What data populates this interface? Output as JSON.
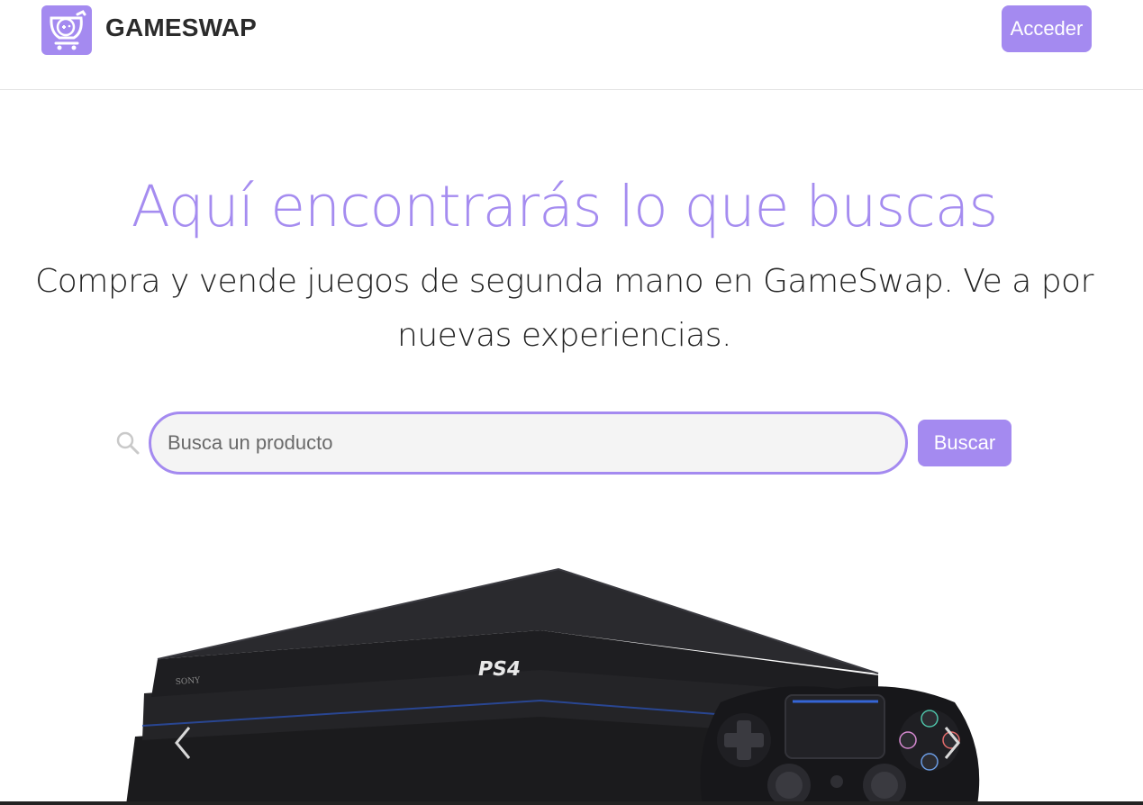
{
  "header": {
    "brand": "GAMESWAP",
    "logo_icon": "gamepad-cart-icon",
    "login_label": "Acceder"
  },
  "hero": {
    "title": "Aquí encontrarás lo que buscas",
    "subtitle": "Compra y vende juegos de segunda mano en GameSwap. Ve a por nuevas experiencias."
  },
  "search": {
    "placeholder": "Busca un producto",
    "value": "",
    "button_label": "Buscar",
    "icon": "search-icon"
  },
  "carousel": {
    "image_subject": "PS4 Pro console with DualShock 4 controller",
    "prev_icon": "chevron-left-icon",
    "next_icon": "chevron-right-icon"
  },
  "colors": {
    "accent": "#a48af0",
    "title": "#a58cf0",
    "text": "#222222"
  }
}
